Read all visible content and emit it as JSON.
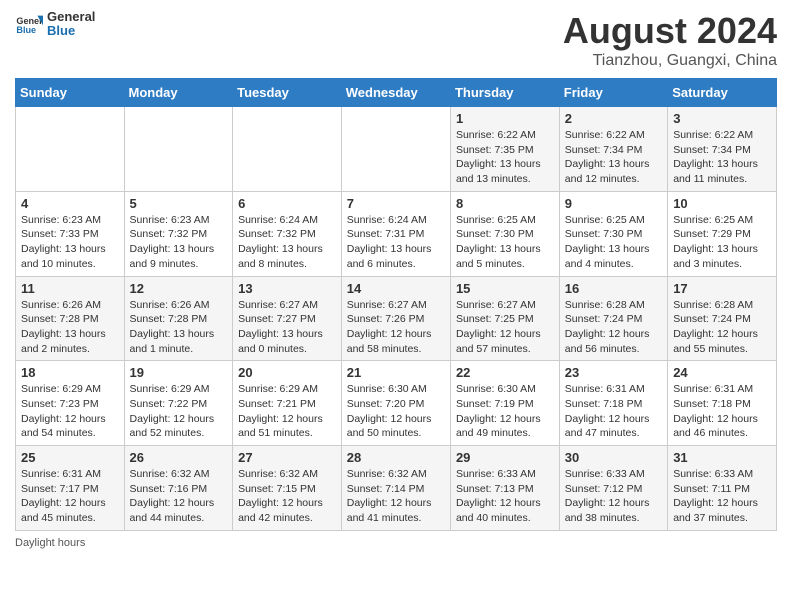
{
  "header": {
    "logo_general": "General",
    "logo_blue": "Blue",
    "main_title": "August 2024",
    "subtitle": "Tianzhou, Guangxi, China"
  },
  "calendar": {
    "days_of_week": [
      "Sunday",
      "Monday",
      "Tuesday",
      "Wednesday",
      "Thursday",
      "Friday",
      "Saturday"
    ],
    "weeks": [
      [
        {
          "day": "",
          "info": ""
        },
        {
          "day": "",
          "info": ""
        },
        {
          "day": "",
          "info": ""
        },
        {
          "day": "",
          "info": ""
        },
        {
          "day": "1",
          "info": "Sunrise: 6:22 AM\nSunset: 7:35 PM\nDaylight: 13 hours and 13 minutes."
        },
        {
          "day": "2",
          "info": "Sunrise: 6:22 AM\nSunset: 7:34 PM\nDaylight: 13 hours and 12 minutes."
        },
        {
          "day": "3",
          "info": "Sunrise: 6:22 AM\nSunset: 7:34 PM\nDaylight: 13 hours and 11 minutes."
        }
      ],
      [
        {
          "day": "4",
          "info": "Sunrise: 6:23 AM\nSunset: 7:33 PM\nDaylight: 13 hours and 10 minutes."
        },
        {
          "day": "5",
          "info": "Sunrise: 6:23 AM\nSunset: 7:32 PM\nDaylight: 13 hours and 9 minutes."
        },
        {
          "day": "6",
          "info": "Sunrise: 6:24 AM\nSunset: 7:32 PM\nDaylight: 13 hours and 8 minutes."
        },
        {
          "day": "7",
          "info": "Sunrise: 6:24 AM\nSunset: 7:31 PM\nDaylight: 13 hours and 6 minutes."
        },
        {
          "day": "8",
          "info": "Sunrise: 6:25 AM\nSunset: 7:30 PM\nDaylight: 13 hours and 5 minutes."
        },
        {
          "day": "9",
          "info": "Sunrise: 6:25 AM\nSunset: 7:30 PM\nDaylight: 13 hours and 4 minutes."
        },
        {
          "day": "10",
          "info": "Sunrise: 6:25 AM\nSunset: 7:29 PM\nDaylight: 13 hours and 3 minutes."
        }
      ],
      [
        {
          "day": "11",
          "info": "Sunrise: 6:26 AM\nSunset: 7:28 PM\nDaylight: 13 hours and 2 minutes."
        },
        {
          "day": "12",
          "info": "Sunrise: 6:26 AM\nSunset: 7:28 PM\nDaylight: 13 hours and 1 minute."
        },
        {
          "day": "13",
          "info": "Sunrise: 6:27 AM\nSunset: 7:27 PM\nDaylight: 13 hours and 0 minutes."
        },
        {
          "day": "14",
          "info": "Sunrise: 6:27 AM\nSunset: 7:26 PM\nDaylight: 12 hours and 58 minutes."
        },
        {
          "day": "15",
          "info": "Sunrise: 6:27 AM\nSunset: 7:25 PM\nDaylight: 12 hours and 57 minutes."
        },
        {
          "day": "16",
          "info": "Sunrise: 6:28 AM\nSunset: 7:24 PM\nDaylight: 12 hours and 56 minutes."
        },
        {
          "day": "17",
          "info": "Sunrise: 6:28 AM\nSunset: 7:24 PM\nDaylight: 12 hours and 55 minutes."
        }
      ],
      [
        {
          "day": "18",
          "info": "Sunrise: 6:29 AM\nSunset: 7:23 PM\nDaylight: 12 hours and 54 minutes."
        },
        {
          "day": "19",
          "info": "Sunrise: 6:29 AM\nSunset: 7:22 PM\nDaylight: 12 hours and 52 minutes."
        },
        {
          "day": "20",
          "info": "Sunrise: 6:29 AM\nSunset: 7:21 PM\nDaylight: 12 hours and 51 minutes."
        },
        {
          "day": "21",
          "info": "Sunrise: 6:30 AM\nSunset: 7:20 PM\nDaylight: 12 hours and 50 minutes."
        },
        {
          "day": "22",
          "info": "Sunrise: 6:30 AM\nSunset: 7:19 PM\nDaylight: 12 hours and 49 minutes."
        },
        {
          "day": "23",
          "info": "Sunrise: 6:31 AM\nSunset: 7:18 PM\nDaylight: 12 hours and 47 minutes."
        },
        {
          "day": "24",
          "info": "Sunrise: 6:31 AM\nSunset: 7:18 PM\nDaylight: 12 hours and 46 minutes."
        }
      ],
      [
        {
          "day": "25",
          "info": "Sunrise: 6:31 AM\nSunset: 7:17 PM\nDaylight: 12 hours and 45 minutes."
        },
        {
          "day": "26",
          "info": "Sunrise: 6:32 AM\nSunset: 7:16 PM\nDaylight: 12 hours and 44 minutes."
        },
        {
          "day": "27",
          "info": "Sunrise: 6:32 AM\nSunset: 7:15 PM\nDaylight: 12 hours and 42 minutes."
        },
        {
          "day": "28",
          "info": "Sunrise: 6:32 AM\nSunset: 7:14 PM\nDaylight: 12 hours and 41 minutes."
        },
        {
          "day": "29",
          "info": "Sunrise: 6:33 AM\nSunset: 7:13 PM\nDaylight: 12 hours and 40 minutes."
        },
        {
          "day": "30",
          "info": "Sunrise: 6:33 AM\nSunset: 7:12 PM\nDaylight: 12 hours and 38 minutes."
        },
        {
          "day": "31",
          "info": "Sunrise: 6:33 AM\nSunset: 7:11 PM\nDaylight: 12 hours and 37 minutes."
        }
      ]
    ]
  },
  "footer": {
    "note": "Daylight hours"
  }
}
